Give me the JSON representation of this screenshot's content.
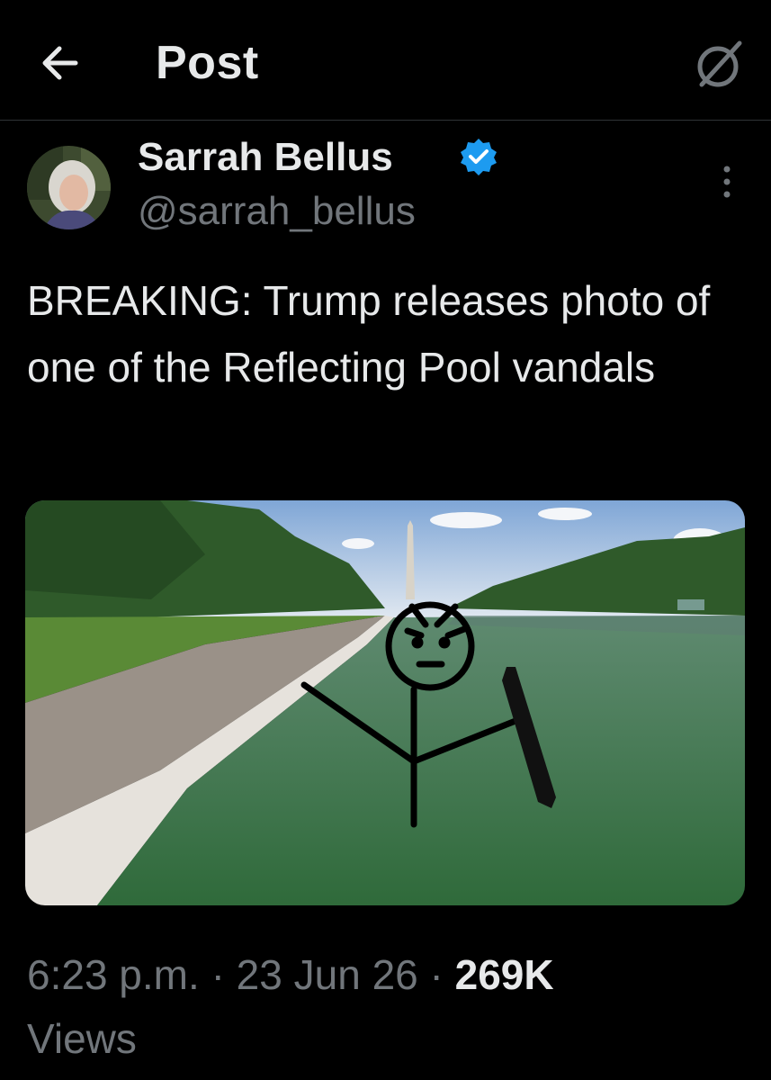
{
  "header": {
    "title": "Post"
  },
  "post": {
    "author_name": "Sarrah Bellus",
    "author_handle": "@sarrah_bellus",
    "text": "BREAKING: Trump releases photo of one of the Reflecting Pool vandals",
    "time": "6:23 p.m.",
    "date": "23 Jun 26",
    "separator": "·",
    "views_count": "269K",
    "views_label": "Views"
  },
  "icons": {
    "back": "arrow-left-icon",
    "grok": "grok-icon",
    "verified": "verified-badge-icon",
    "more": "more-vertical-icon"
  },
  "colors": {
    "background": "#000000",
    "verified_badge": "#1d9bf0",
    "secondary_text": "#71767b"
  }
}
